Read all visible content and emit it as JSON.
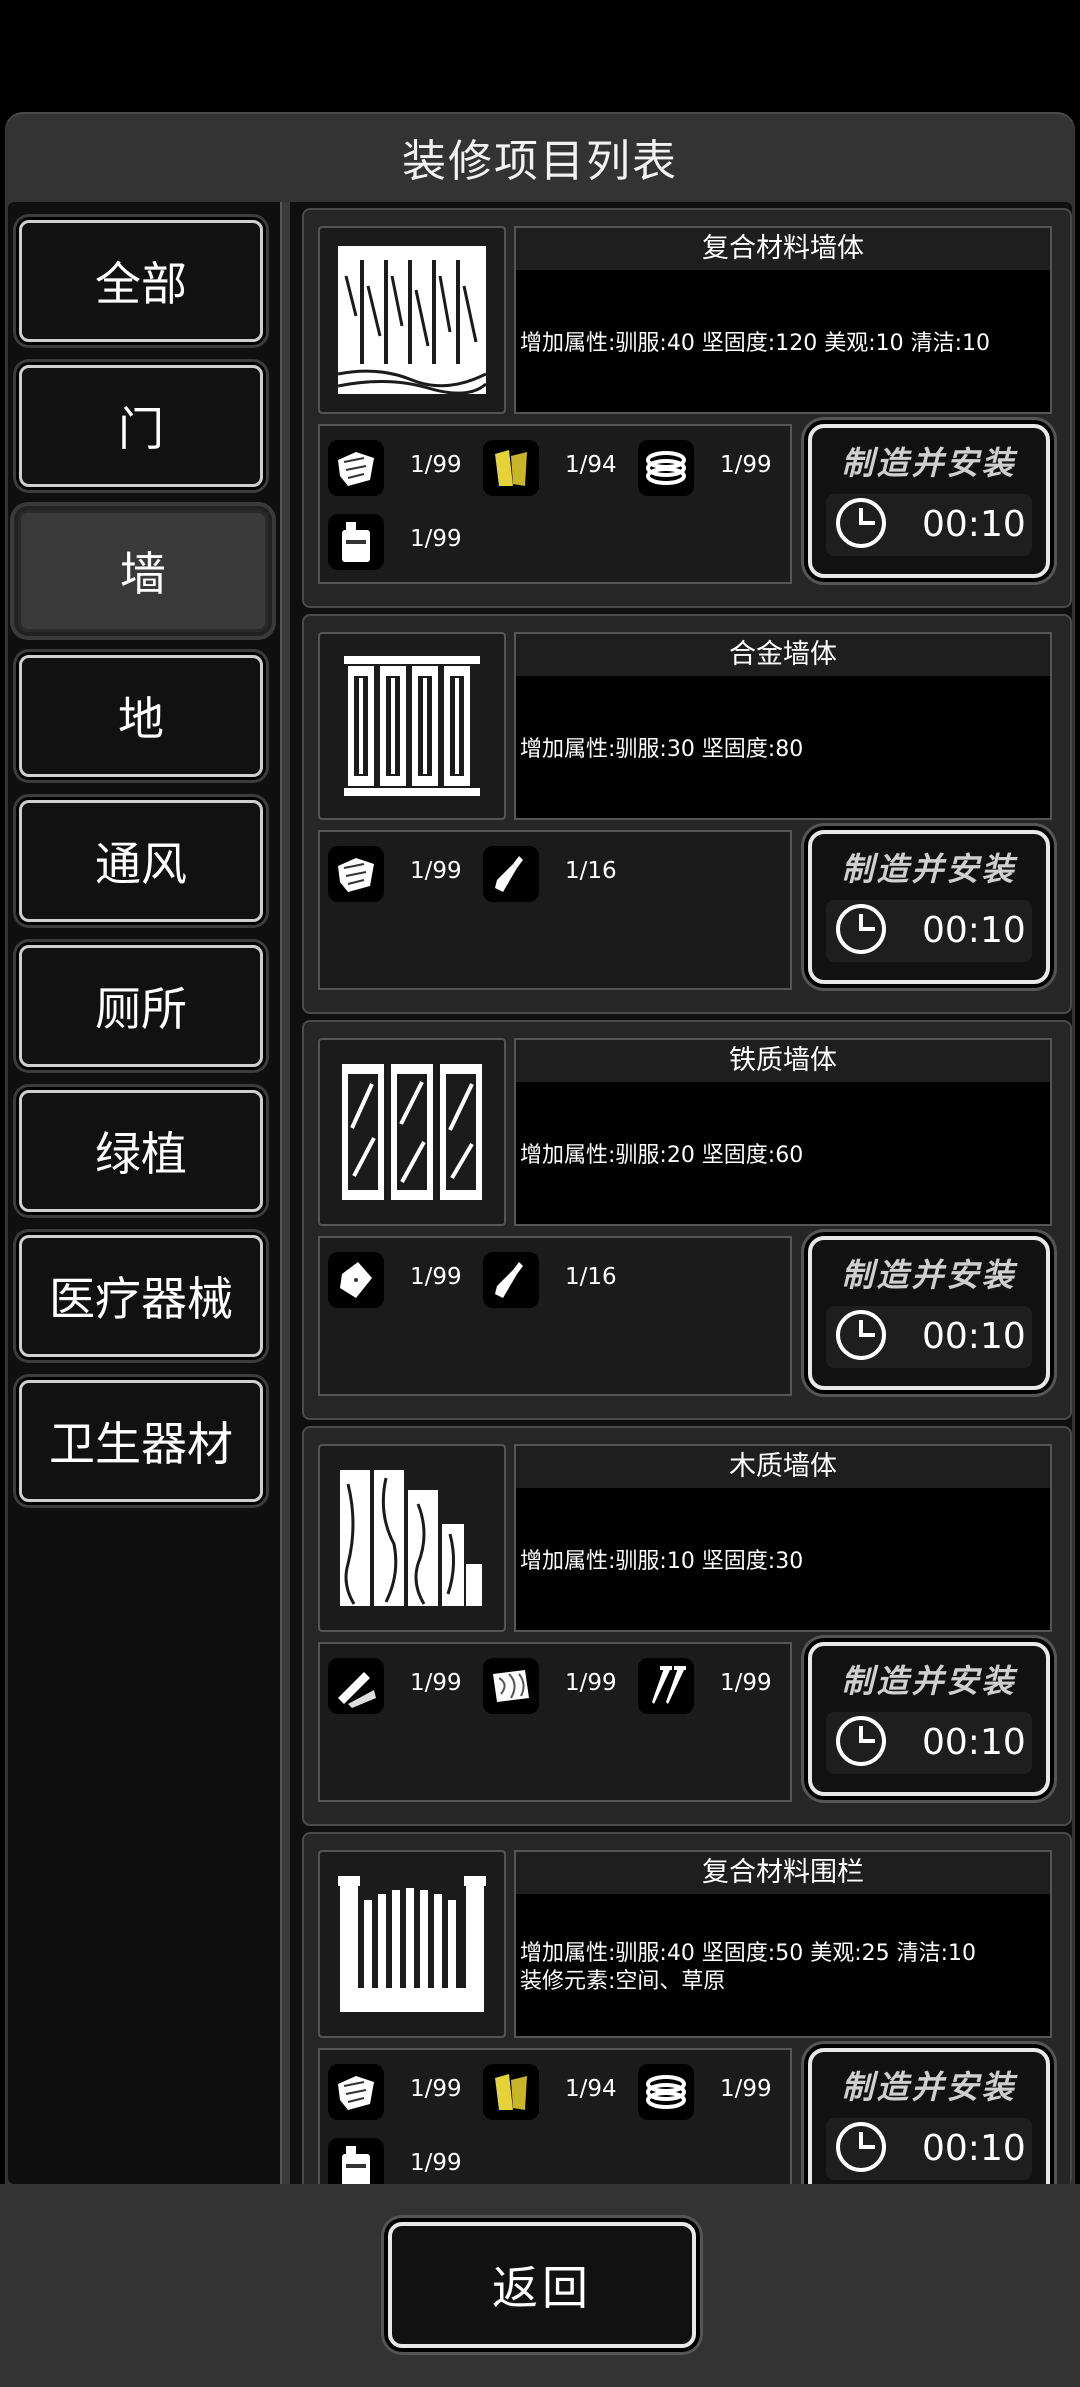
{
  "header": {
    "title": "装修项目列表"
  },
  "sidebar": {
    "items": [
      {
        "label": "全部"
      },
      {
        "label": "门"
      },
      {
        "label": "墙",
        "active": true
      },
      {
        "label": "地"
      },
      {
        "label": "通风"
      },
      {
        "label": "厕所"
      },
      {
        "label": "绿植"
      },
      {
        "label": "医疗器械"
      },
      {
        "label": "卫生器材"
      }
    ]
  },
  "items": [
    {
      "name": "复合材料墙体",
      "desc": [
        "增加属性:驯服:40 坚固度:120 美观:10 清洁:10"
      ],
      "thumb_icon": "composite-wall-icon",
      "materials": [
        {
          "icon": "scrap-metal-icon",
          "qty": "1/99"
        },
        {
          "icon": "yellow-plank-icon",
          "qty": "1/94"
        },
        {
          "icon": "cable-coil-icon",
          "qty": "1/99"
        },
        {
          "icon": "jerrycan-icon",
          "qty": "1/99"
        }
      ],
      "craft_label": "制造并安装",
      "time": "00:10"
    },
    {
      "name": "合金墙体",
      "desc": [
        "增加属性:驯服:30 坚固度:80"
      ],
      "thumb_icon": "alloy-wall-icon",
      "materials": [
        {
          "icon": "scrap-metal-icon",
          "qty": "1/99"
        },
        {
          "icon": "glue-tube-icon",
          "qty": "1/16"
        }
      ],
      "craft_label": "制造并安装",
      "time": "00:10"
    },
    {
      "name": "铁质墙体",
      "desc": [
        "增加属性:驯服:20 坚固度:60"
      ],
      "thumb_icon": "iron-wall-icon",
      "materials": [
        {
          "icon": "metal-plate-icon",
          "qty": "1/99"
        },
        {
          "icon": "glue-tube-icon",
          "qty": "1/16"
        }
      ],
      "craft_label": "制造并安装",
      "time": "00:10"
    },
    {
      "name": "木质墙体",
      "desc": [
        "增加属性:驯服:10 坚固度:30"
      ],
      "thumb_icon": "wood-wall-icon",
      "materials": [
        {
          "icon": "wood-planks-icon",
          "qty": "1/99"
        },
        {
          "icon": "log-icon",
          "qty": "1/99"
        },
        {
          "icon": "nails-icon",
          "qty": "1/99"
        }
      ],
      "craft_label": "制造并安装",
      "time": "00:10"
    },
    {
      "name": "复合材料围栏",
      "desc": [
        "增加属性:驯服:40 坚固度:50 美观:25 清洁:10",
        "装修元素:空间、草原"
      ],
      "thumb_icon": "fence-icon",
      "materials": [
        {
          "icon": "scrap-metal-icon",
          "qty": "1/99"
        },
        {
          "icon": "yellow-plank-icon",
          "qty": "1/94"
        },
        {
          "icon": "cable-coil-icon",
          "qty": "1/99"
        },
        {
          "icon": "jerrycan-icon",
          "qty": "1/99"
        }
      ],
      "craft_label": "制造并安装",
      "time": "00:10"
    }
  ],
  "footer": {
    "back_label": "返回"
  },
  "colors": {
    "background": "#000000",
    "panel": "#333333",
    "accent_yellow": "#e6d23a"
  }
}
